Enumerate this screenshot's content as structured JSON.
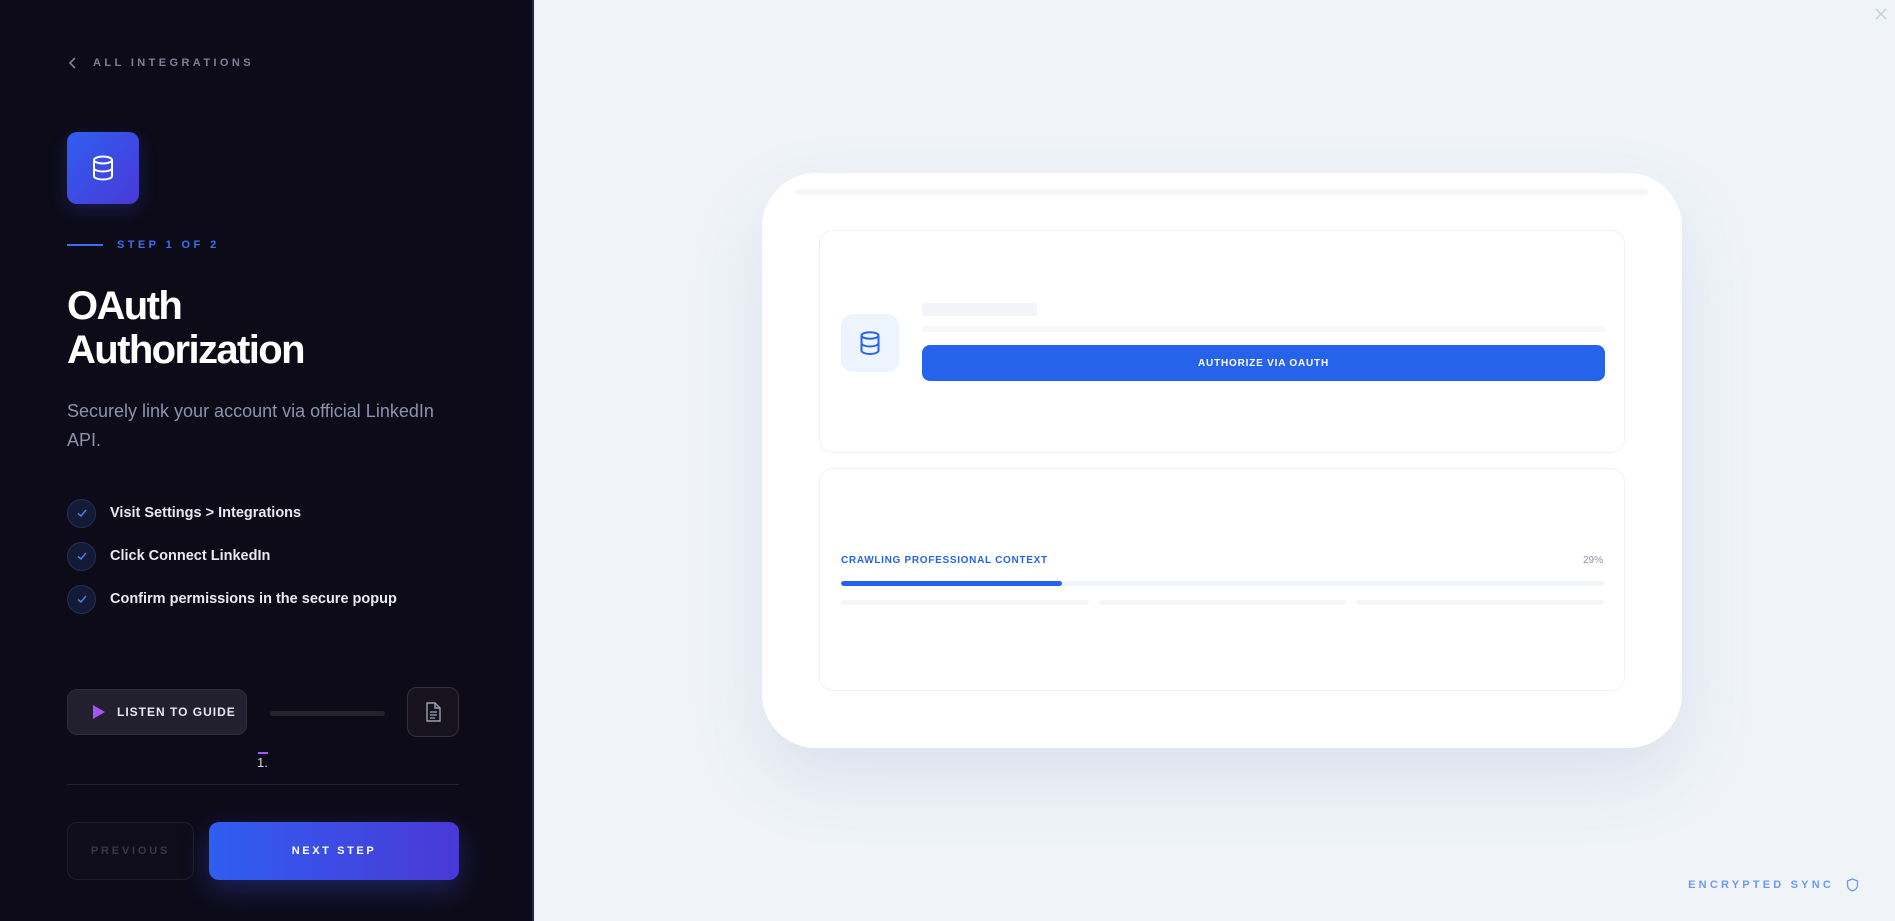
{
  "back": {
    "label": "ALL INTEGRATIONS",
    "icon": "chevron-left-icon"
  },
  "app": {
    "icon": "database-icon"
  },
  "step": {
    "label": "STEP 1 OF 2"
  },
  "heading": {
    "line1": "OAuth",
    "line2": "Authorization"
  },
  "subtitle": "Securely link your account via official LinkedIn API.",
  "checklist": [
    {
      "label": "Visit Settings > Integrations"
    },
    {
      "label": "Click Connect LinkedIn"
    },
    {
      "label": "Confirm permissions in the secure popup"
    }
  ],
  "audio": {
    "label": "LISTEN TO GUIDE",
    "icon": "play-icon",
    "caption": "1."
  },
  "transcript": {
    "icon": "document-icon"
  },
  "nav": {
    "previous": "PREVIOUS",
    "next": "NEXT STEP"
  },
  "preview": {
    "authorize_button": "AUTHORIZE VIA OAUTH",
    "progress_label": "CRAWLING PROFESSIONAL CONTEXT",
    "progress_percent": "29%",
    "progress_value": 0.29
  },
  "footer": {
    "label": "ENCRYPTED SYNC",
    "icon": "shield-icon"
  },
  "colors": {
    "accent": "#2563eb",
    "accent_gradient_end": "#4a39d6",
    "panel_dark": "#0d0b18",
    "play": "#a855f7"
  }
}
